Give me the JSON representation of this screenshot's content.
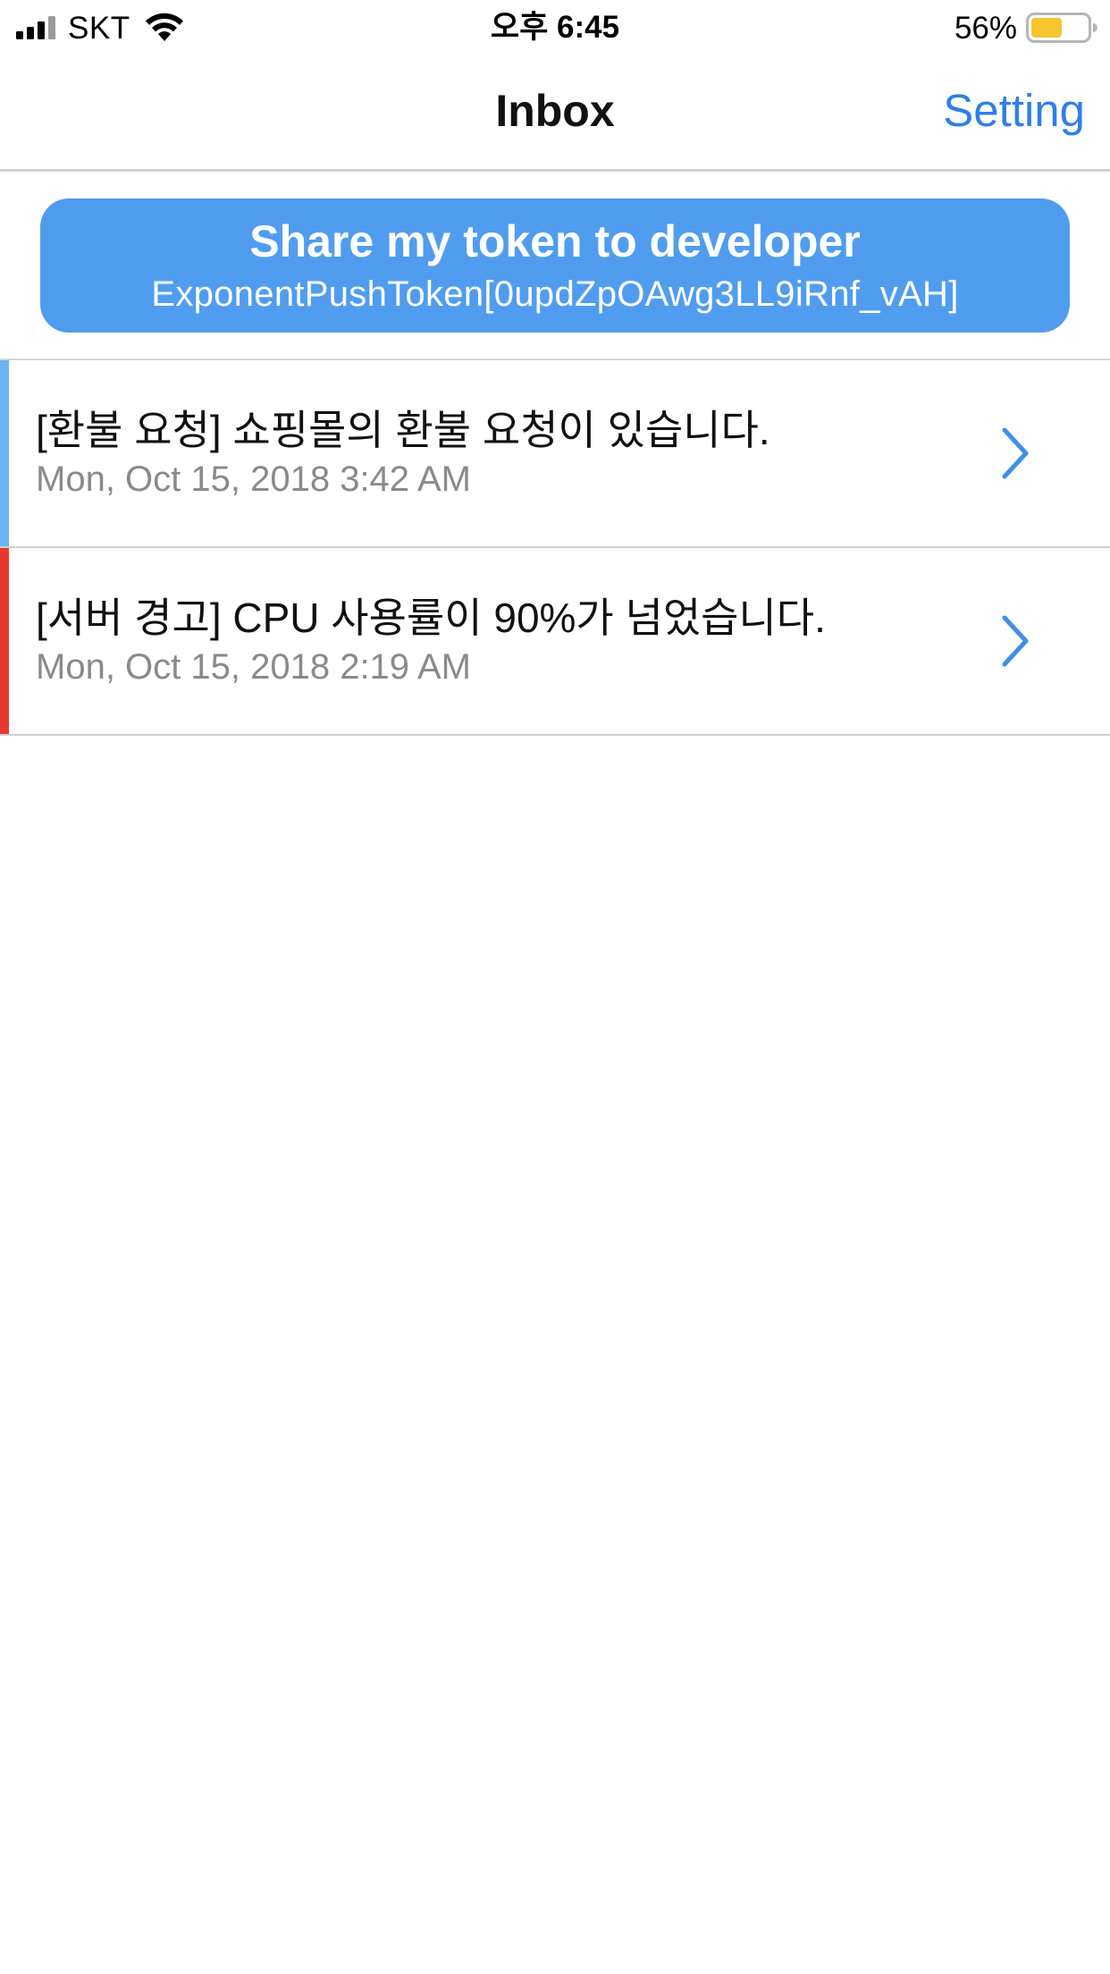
{
  "status_bar": {
    "carrier": "SKT",
    "time": "오후 6:45",
    "battery_percent": "56%",
    "battery_level": 0.56,
    "battery_color": "#f7c52f"
  },
  "nav": {
    "title": "Inbox",
    "setting_label": "Setting",
    "accent_color": "#2f7fe6"
  },
  "token_button": {
    "title": "Share my token to developer",
    "token": "ExponentPushToken[0updZpOAwg3LL9iRnf_vAH]",
    "color": "#509def"
  },
  "messages": [
    {
      "title": "[환불 요청] 쇼핑몰의 환불 요청이 있습니다.",
      "date": "Mon, Oct 15, 2018 3:42 AM",
      "accent_color": "#6ab4f2",
      "icon": "chevron-right-icon"
    },
    {
      "title": "[서버 경고] CPU 사용률이 90%가 넘었습니다.",
      "date": "Mon, Oct 15, 2018 2:19 AM",
      "accent_color": "#e8392f",
      "icon": "chevron-right-icon"
    }
  ]
}
